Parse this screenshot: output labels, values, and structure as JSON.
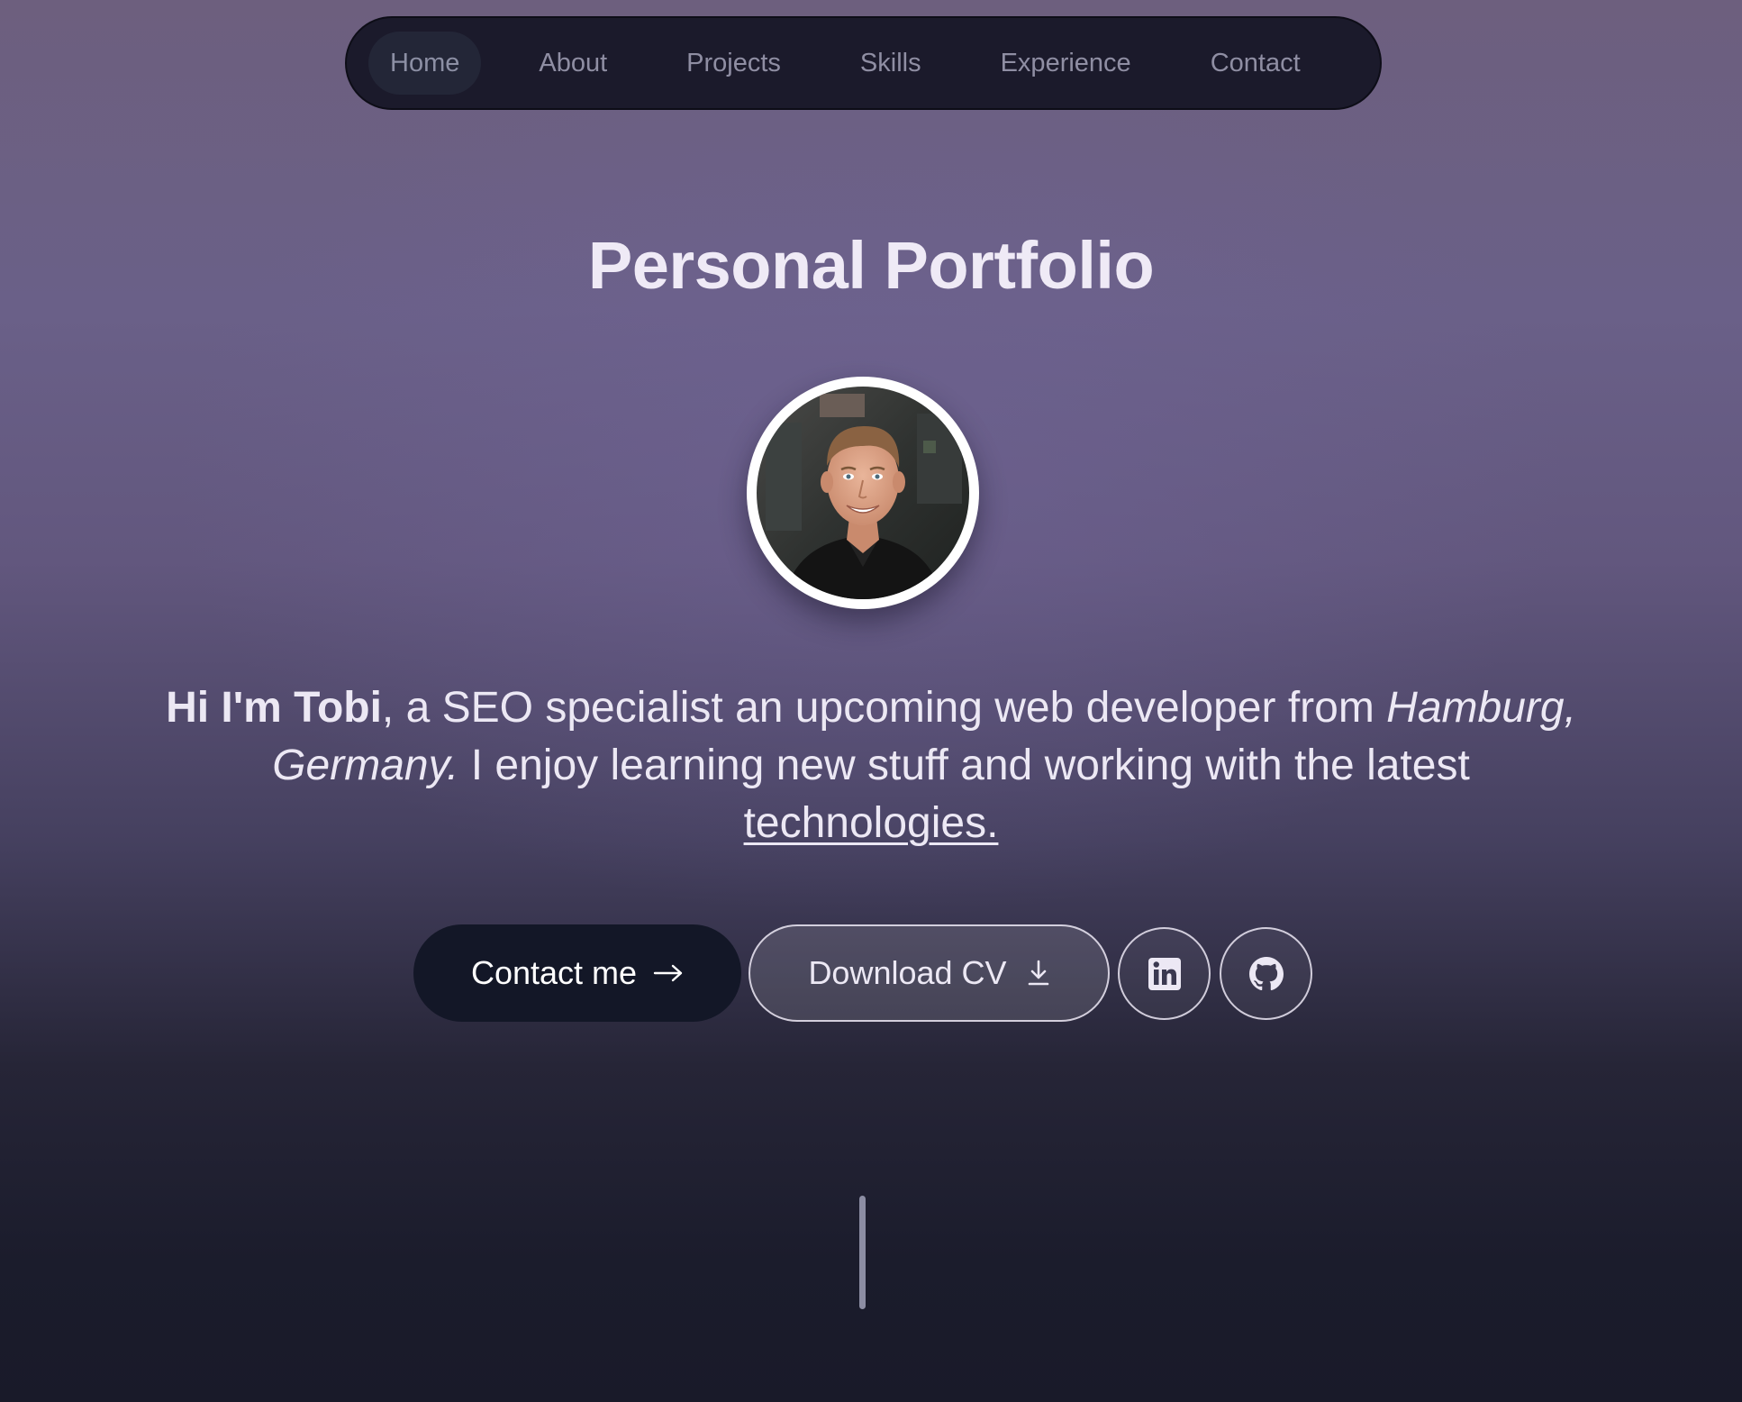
{
  "nav": {
    "items": [
      {
        "label": "Home",
        "active": true
      },
      {
        "label": "About",
        "active": false
      },
      {
        "label": "Projects",
        "active": false
      },
      {
        "label": "Skills",
        "active": false
      },
      {
        "label": "Experience",
        "active": false
      },
      {
        "label": "Contact",
        "active": false
      }
    ]
  },
  "hero": {
    "title": "Personal Portfolio",
    "avatar_icon": "profile-photo",
    "intro": {
      "name_bold": "Hi I'm Tobi",
      "part1": ", a SEO specialist an upcoming web developer from ",
      "location_italic": "Hamburg, Germany.",
      "part2": " I enjoy learning new stuff and working with the latest ",
      "link_underlined": "technologies."
    }
  },
  "actions": {
    "contact_label": "Contact me",
    "contact_icon": "arrow-right-icon",
    "cv_label": "Download CV",
    "cv_icon": "download-icon",
    "linkedin_icon": "linkedin-icon",
    "github_icon": "github-icon"
  },
  "colors": {
    "nav_bg": "#1b1a2b",
    "primary_button_bg": "#131727",
    "text": "#ece8f4"
  }
}
